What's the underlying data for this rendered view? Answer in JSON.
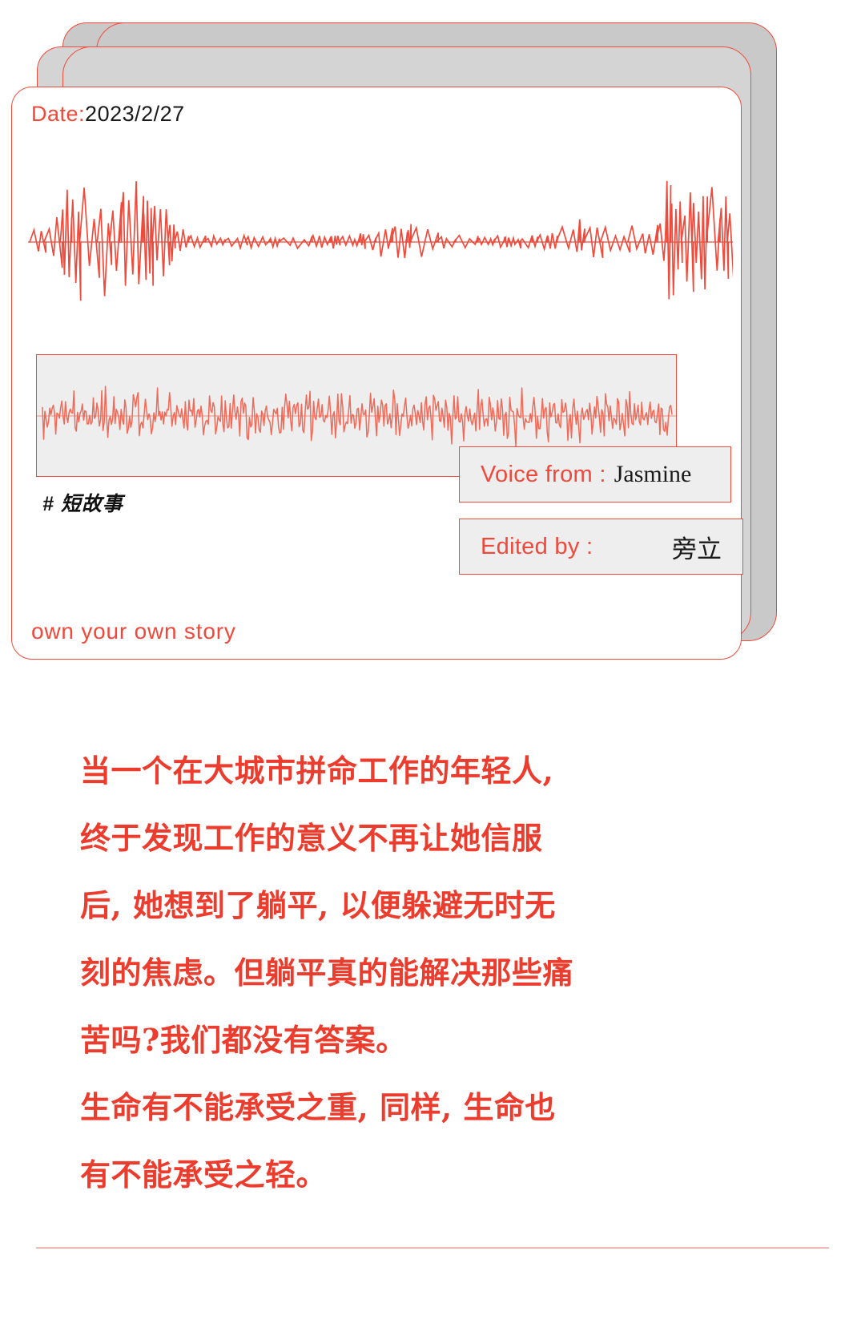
{
  "card": {
    "date_label": "Date:",
    "date_value": "2023/2/27",
    "hashtag": "# 短故事",
    "tagline": "own your own story",
    "credits": {
      "voice_label": "Voice from :",
      "voice_value": "Jasmine",
      "edited_label": "Edited by :",
      "edited_value": "旁立"
    },
    "icons": {
      "scribble_waveform": "waveform-scribble-icon",
      "panel_waveform": "waveform-line-icon"
    }
  },
  "theme": {
    "accent": "#ef4b3c",
    "body_red": "#ec3c2d",
    "panel_grey": "#eeeeee",
    "folder_grey": "#c9c9c9",
    "ink": "#1a1a1a",
    "rule": "#f0b9b2"
  },
  "story": {
    "lines": [
      "当一个在大城市拼命工作的年轻人,",
      "终于发现工作的意义不再让她信服",
      "后, 她想到了躺平, 以便躲避无时无",
      "刻的焦虑。但躺平真的能解决那些痛",
      "苦吗?我们都没有答案。",
      "生命有不能承受之重, 同样, 生命也",
      "有不能承受之轻。"
    ]
  }
}
